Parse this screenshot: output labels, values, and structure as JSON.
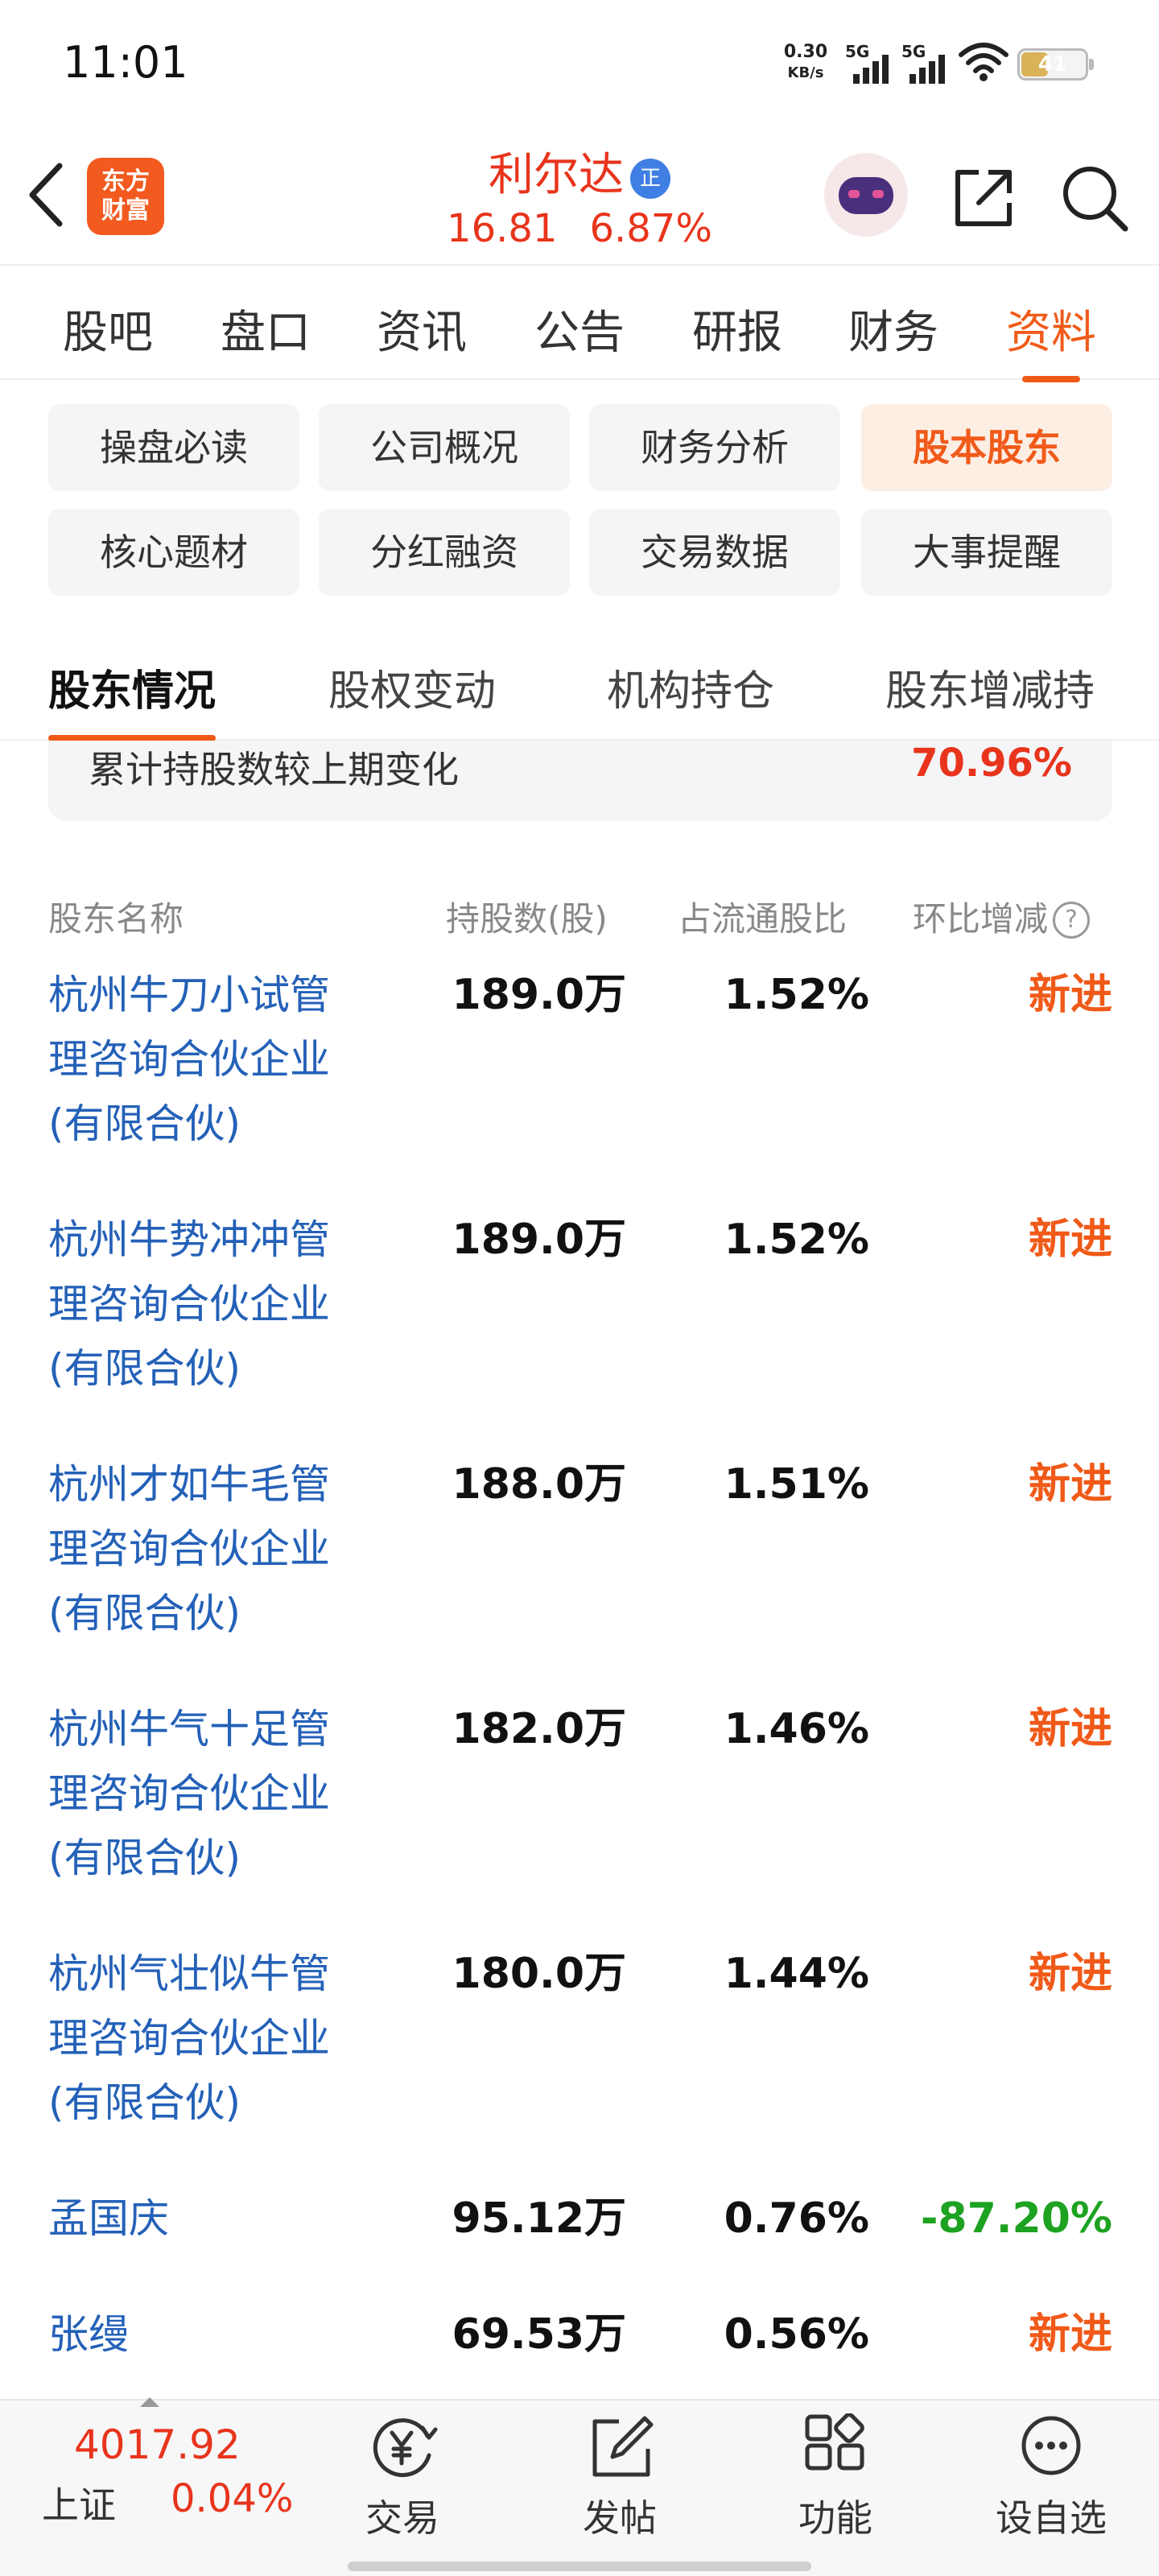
{
  "status_bar": {
    "time": "11:01",
    "net_speed_value": "0.30",
    "net_speed_unit": "KB/s",
    "signal1_label": "5G",
    "signal2_label": "5G",
    "battery_level": "41"
  },
  "header": {
    "logo_line1": "东方",
    "logo_line2": "财富",
    "stock_name": "利尔达",
    "cert_badge": "正",
    "price": "16.81",
    "change_pct": "6.87%",
    "accent_color": "#e8341c"
  },
  "main_tabs": [
    {
      "label": "股吧"
    },
    {
      "label": "盘口"
    },
    {
      "label": "资讯"
    },
    {
      "label": "公告"
    },
    {
      "label": "研报"
    },
    {
      "label": "财务"
    },
    {
      "label": "资料",
      "active": true
    }
  ],
  "sub_buttons": [
    {
      "label": "操盘必读"
    },
    {
      "label": "公司概况"
    },
    {
      "label": "财务分析"
    },
    {
      "label": "股本股东",
      "active": true
    },
    {
      "label": "核心题材"
    },
    {
      "label": "分红融资"
    },
    {
      "label": "交易数据"
    },
    {
      "label": "大事提醒"
    }
  ],
  "section_tabs": [
    {
      "label": "股东情况",
      "active": true
    },
    {
      "label": "股权变动"
    },
    {
      "label": "机构持仓"
    },
    {
      "label": "股东增减持"
    }
  ],
  "summary": {
    "label": "累计持股数较上期变化",
    "value": "70.96%"
  },
  "table": {
    "headers": {
      "name": "股东名称",
      "shares": "持股数(股)",
      "ratio": "占流通股比",
      "change": "环比增减"
    },
    "help_icon": "?",
    "rows": [
      {
        "name_lines": [
          "杭州牛刀小试管",
          "理咨询合伙企业",
          "(有限合伙)"
        ],
        "shares": "189.0万",
        "ratio": "1.52%",
        "change": "新进",
        "change_dir": "new"
      },
      {
        "name_lines": [
          "杭州牛势冲冲管",
          "理咨询合伙企业",
          "(有限合伙)"
        ],
        "shares": "189.0万",
        "ratio": "1.52%",
        "change": "新进",
        "change_dir": "new"
      },
      {
        "name_lines": [
          "杭州才如牛毛管",
          "理咨询合伙企业",
          "(有限合伙)"
        ],
        "shares": "188.0万",
        "ratio": "1.51%",
        "change": "新进",
        "change_dir": "new"
      },
      {
        "name_lines": [
          "杭州牛气十足管",
          "理咨询合伙企业",
          "(有限合伙)"
        ],
        "shares": "182.0万",
        "ratio": "1.46%",
        "change": "新进",
        "change_dir": "new"
      },
      {
        "name_lines": [
          "杭州气壮似牛管",
          "理咨询合伙企业",
          "(有限合伙)"
        ],
        "shares": "180.0万",
        "ratio": "1.44%",
        "change": "新进",
        "change_dir": "new"
      },
      {
        "name_lines": [
          "孟国庆"
        ],
        "shares": "95.12万",
        "ratio": "0.76%",
        "change": "-87.20%",
        "change_dir": "down"
      },
      {
        "name_lines": [
          "张缦"
        ],
        "shares": "69.53万",
        "ratio": "0.56%",
        "change": "新进",
        "change_dir": "new"
      }
    ]
  },
  "bottom_bar": {
    "index_value": "4017.92",
    "index_name": "上证",
    "index_change": "0.04%",
    "items": [
      {
        "label": "交易",
        "icon": "trade-icon"
      },
      {
        "label": "发帖",
        "icon": "post-icon"
      },
      {
        "label": "功能",
        "icon": "functions-icon"
      },
      {
        "label": "设自选",
        "icon": "more-icon"
      }
    ]
  }
}
